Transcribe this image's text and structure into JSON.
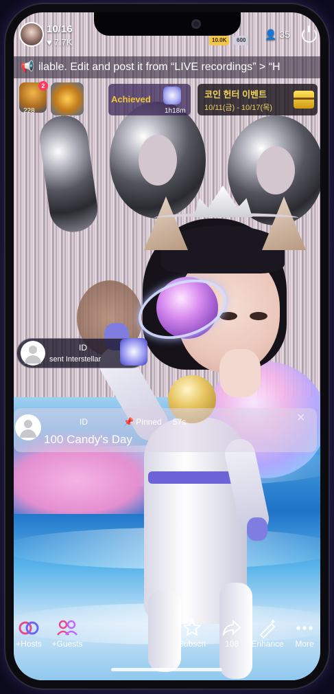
{
  "host": {
    "date": "10/16",
    "likes": "7.7K"
  },
  "header": {
    "badge_1": "10.0K",
    "badge_2": "600",
    "viewers": "35"
  },
  "announcement": {
    "text": "ilable. Edit and post it from “LIVE recordings” > “H"
  },
  "rank": {
    "notification": "2",
    "count": "228"
  },
  "achievement": {
    "label": "Achieved",
    "time": "1h18m"
  },
  "event": {
    "title": "코인 헌터 이벤트",
    "dates": "10/11(금) - 10/17(목)"
  },
  "gift_toast": {
    "name": "ID",
    "text": "sent Interstellar"
  },
  "pinned": {
    "name": "ID",
    "label": "Pinned",
    "time": "57s",
    "message": "100 Candy's Day"
  },
  "bottom_bar": [
    {
      "label": "+Hosts",
      "icon": "hosts-icon"
    },
    {
      "label": "+Guests",
      "icon": "guests-icon"
    },
    {
      "label": "Subscri",
      "icon": "subscribe-icon"
    },
    {
      "label": "108",
      "icon": "share-icon"
    },
    {
      "label": "Enhance",
      "icon": "enhance-icon"
    },
    {
      "label": "More",
      "icon": "more-icon"
    }
  ],
  "colors": {
    "accent_gold": "#f0c63a",
    "event_yellow": "#f0d35c",
    "badge_red": "#ff3b5c",
    "hosts_pink": "#e54b8a",
    "guests_purple": "#c069ff"
  }
}
